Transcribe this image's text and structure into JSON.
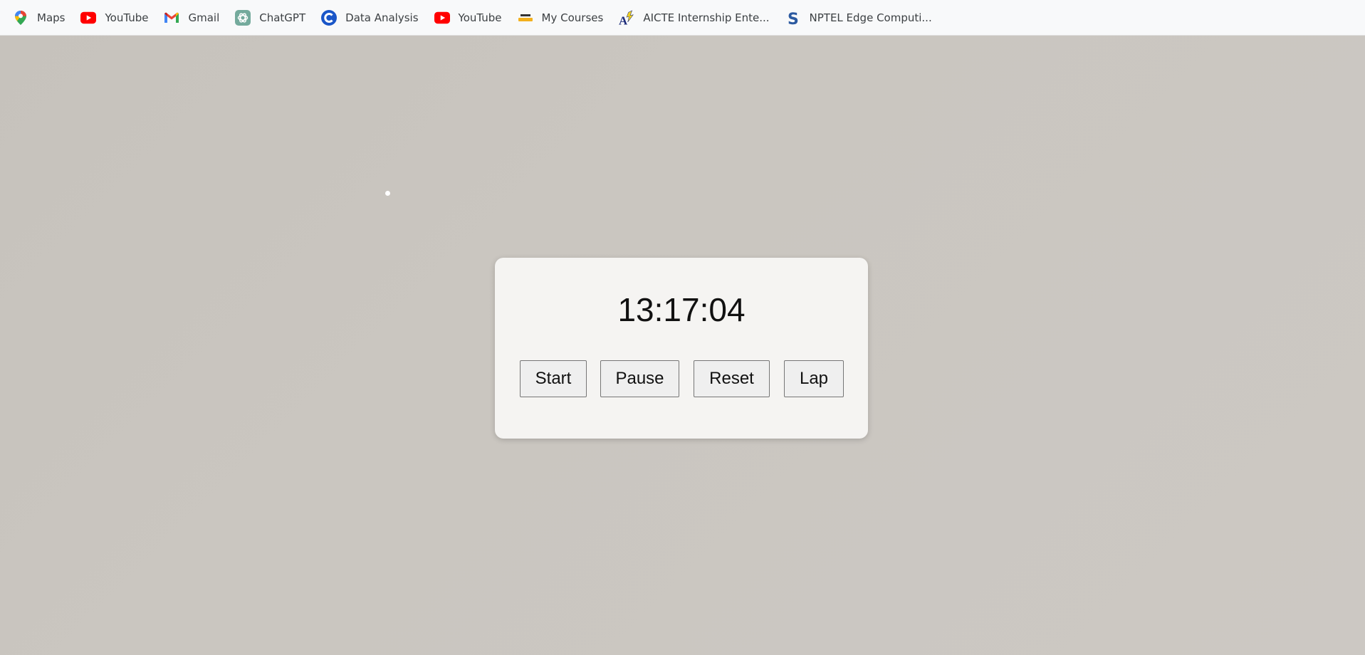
{
  "bookmarks": [
    {
      "label": "Maps",
      "icon": "maps-pin-icon"
    },
    {
      "label": "YouTube",
      "icon": "youtube-icon"
    },
    {
      "label": "Gmail",
      "icon": "gmail-icon"
    },
    {
      "label": "ChatGPT",
      "icon": "chatgpt-icon"
    },
    {
      "label": "Data Analysis",
      "icon": "data-analysis-c-icon"
    },
    {
      "label": "YouTube",
      "icon": "youtube-icon"
    },
    {
      "label": "My Courses",
      "icon": "my-courses-icon"
    },
    {
      "label": "AICTE Internship Ente...",
      "icon": "aicte-icon"
    },
    {
      "label": "NPTEL Edge Computi...",
      "icon": "nptel-s-icon"
    }
  ],
  "stopwatch": {
    "time": "13:17:04",
    "buttons": {
      "start": "Start",
      "pause": "Pause",
      "reset": "Reset",
      "lap": "Lap"
    }
  },
  "colors": {
    "page_background": "#c9c5bf",
    "card_background": "#f5f4f2",
    "bookmarks_bar": "#f8f9fa",
    "youtube_red": "#ff0000"
  }
}
